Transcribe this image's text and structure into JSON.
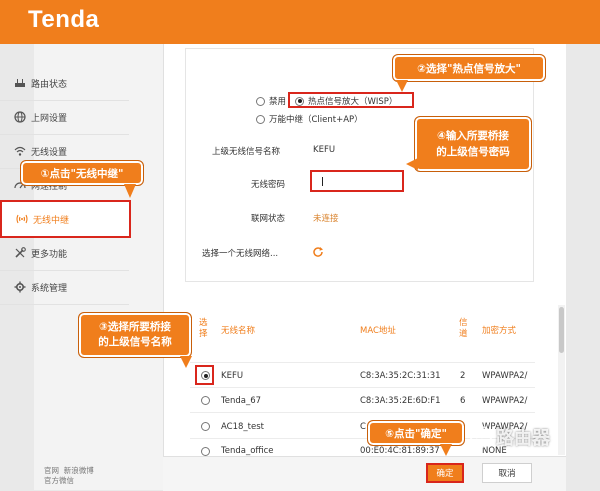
{
  "brand": {
    "logo": "Tenda",
    "color": "#f07e1c"
  },
  "sidebar": {
    "items": [
      {
        "label": "路由状态",
        "icon": "router-icon"
      },
      {
        "label": "上网设置",
        "icon": "globe-icon"
      },
      {
        "label": "无线设置",
        "icon": "wifi-icon"
      },
      {
        "label": "网速控制",
        "icon": "speed-icon"
      },
      {
        "label": "无线中继",
        "icon": "repeater-icon"
      },
      {
        "label": "更多功能",
        "icon": "tools-icon"
      },
      {
        "label": "系统管理",
        "icon": "gear-icon"
      }
    ],
    "footer": [
      "官网",
      "新浪微博",
      "官方微信"
    ]
  },
  "mode": {
    "options": [
      {
        "label": "禁用",
        "selected": false
      },
      {
        "label": "热点信号放大（WISP）",
        "selected": true
      },
      {
        "label": "万能中继（Client+AP）",
        "selected": false
      }
    ]
  },
  "form": {
    "ssid_label": "上级无线信号名称",
    "ssid_value": "KEFU",
    "password_label": "无线密码",
    "password_value": "",
    "status_label": "联网状态",
    "status_value": "未连接",
    "choose_label": "选择一个无线网络...",
    "status_color": "#d9822b"
  },
  "table": {
    "headers": {
      "select": "选择",
      "name": "无线名称",
      "mac": "MAC地址",
      "channel": "信道",
      "security": "加密方式"
    },
    "rows": [
      {
        "selected": true,
        "name": "KEFU",
        "mac": "C8:3A:35:2C:31:31",
        "channel": "2",
        "security": "WPAWPA2/"
      },
      {
        "selected": false,
        "name": "Tenda_67",
        "mac": "C8:3A:35:2E:6D:F1",
        "channel": "6",
        "security": "WPAWPA2/"
      },
      {
        "selected": false,
        "name": "AC18_test",
        "mac": "C",
        "channel": "",
        "security": "WPAWPA2/"
      },
      {
        "selected": false,
        "name": "Tenda_office",
        "mac": "00:E0:4C:81:89:37",
        "channel": "",
        "security": "NONE"
      }
    ]
  },
  "buttons": {
    "ok": "确定",
    "cancel": "取消"
  },
  "callouts": {
    "c1": "①点击\"无线中继\"",
    "c2": "②选择\"热点信号放大\"",
    "c3_line1": "③选择所要桥接",
    "c3_line2": "的上级信号名称",
    "c4_line1": "④输入所要桥接",
    "c4_line2": "的上级信号密码",
    "c5": "⑤点击\"确定\""
  },
  "watermark": "路由器"
}
